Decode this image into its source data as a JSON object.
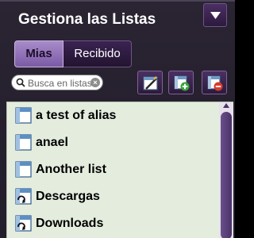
{
  "header": {
    "title": "Gestiona las Listas"
  },
  "tabs": [
    {
      "label": "Mias",
      "active": true
    },
    {
      "label": "Recibido",
      "active": false
    }
  ],
  "search": {
    "placeholder": "Busca en listas"
  },
  "toolbar": {
    "buttons": [
      {
        "icon": "edit-list-icon"
      },
      {
        "icon": "add-list-icon"
      },
      {
        "icon": "remove-list-icon"
      }
    ]
  },
  "lists": [
    {
      "label": "a test of alias",
      "icon": "list-icon"
    },
    {
      "label": "anael",
      "icon": "list-icon"
    },
    {
      "label": "Another list",
      "icon": "list-icon"
    },
    {
      "label": "Descargas",
      "icon": "synced-list-icon"
    },
    {
      "label": "Downloads",
      "icon": "synced-list-icon"
    }
  ],
  "colors": {
    "panel_bg": "#221d2a",
    "accent": "#7c5aa6",
    "list_bg": "#e4ecde"
  }
}
